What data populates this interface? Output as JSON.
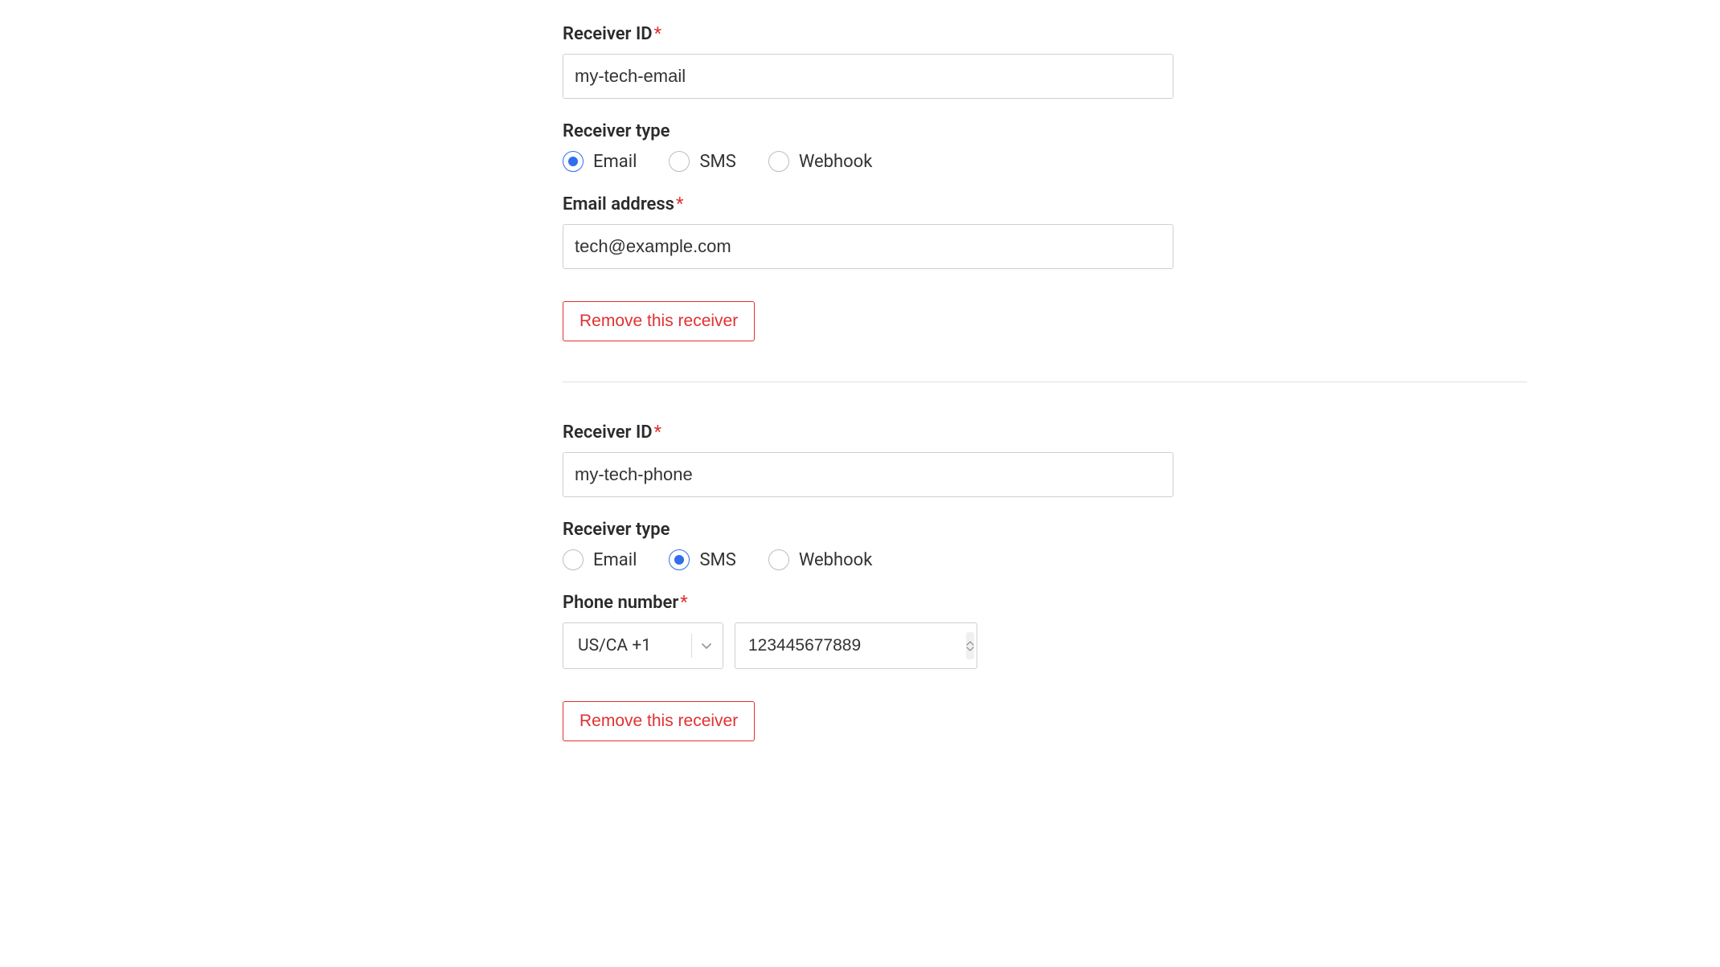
{
  "labels": {
    "receiver_id": "Receiver ID",
    "receiver_type": "Receiver type",
    "email_address": "Email address",
    "phone_number": "Phone number",
    "required_mark": "*"
  },
  "radio_options": {
    "email": "Email",
    "sms": "SMS",
    "webhook": "Webhook"
  },
  "buttons": {
    "remove": "Remove this receiver"
  },
  "receivers": [
    {
      "id_value": "my-tech-email",
      "type_selected": "email",
      "email_value": "tech@example.com"
    },
    {
      "id_value": "my-tech-phone",
      "type_selected": "sms",
      "country_code": "US/CA +1",
      "phone_value": "123445677889"
    }
  ]
}
